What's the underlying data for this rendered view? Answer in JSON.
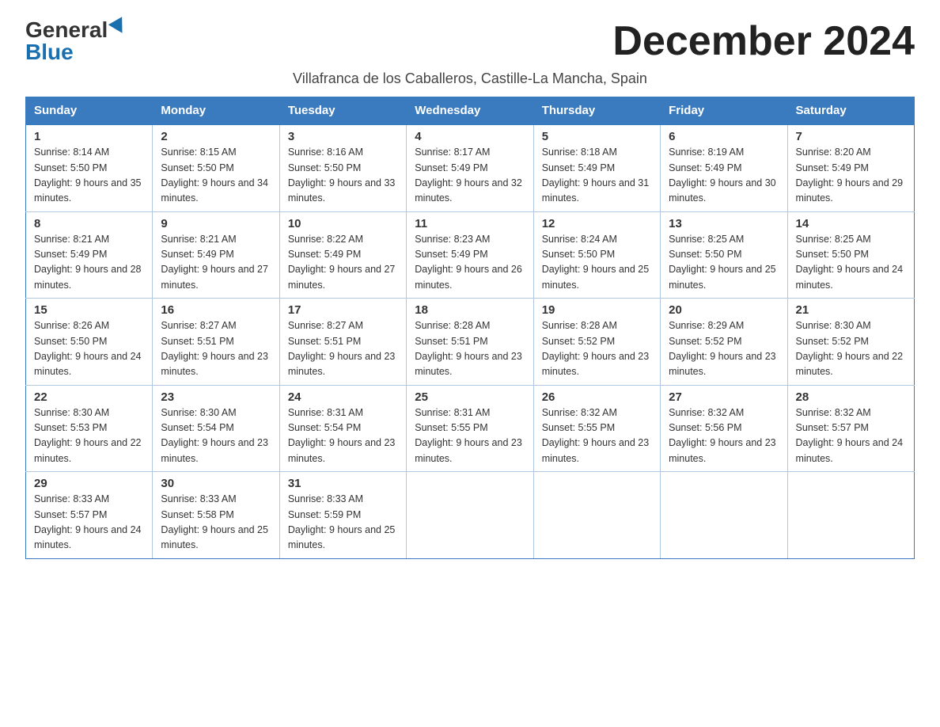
{
  "header": {
    "logo_general": "General",
    "logo_blue": "Blue",
    "month_title": "December 2024",
    "subtitle": "Villafranca de los Caballeros, Castille-La Mancha, Spain"
  },
  "days_of_week": [
    "Sunday",
    "Monday",
    "Tuesday",
    "Wednesday",
    "Thursday",
    "Friday",
    "Saturday"
  ],
  "weeks": [
    [
      {
        "day": "1",
        "sunrise": "8:14 AM",
        "sunset": "5:50 PM",
        "daylight": "9 hours and 35 minutes."
      },
      {
        "day": "2",
        "sunrise": "8:15 AM",
        "sunset": "5:50 PM",
        "daylight": "9 hours and 34 minutes."
      },
      {
        "day": "3",
        "sunrise": "8:16 AM",
        "sunset": "5:50 PM",
        "daylight": "9 hours and 33 minutes."
      },
      {
        "day": "4",
        "sunrise": "8:17 AM",
        "sunset": "5:49 PM",
        "daylight": "9 hours and 32 minutes."
      },
      {
        "day": "5",
        "sunrise": "8:18 AM",
        "sunset": "5:49 PM",
        "daylight": "9 hours and 31 minutes."
      },
      {
        "day": "6",
        "sunrise": "8:19 AM",
        "sunset": "5:49 PM",
        "daylight": "9 hours and 30 minutes."
      },
      {
        "day": "7",
        "sunrise": "8:20 AM",
        "sunset": "5:49 PM",
        "daylight": "9 hours and 29 minutes."
      }
    ],
    [
      {
        "day": "8",
        "sunrise": "8:21 AM",
        "sunset": "5:49 PM",
        "daylight": "9 hours and 28 minutes."
      },
      {
        "day": "9",
        "sunrise": "8:21 AM",
        "sunset": "5:49 PM",
        "daylight": "9 hours and 27 minutes."
      },
      {
        "day": "10",
        "sunrise": "8:22 AM",
        "sunset": "5:49 PM",
        "daylight": "9 hours and 27 minutes."
      },
      {
        "day": "11",
        "sunrise": "8:23 AM",
        "sunset": "5:49 PM",
        "daylight": "9 hours and 26 minutes."
      },
      {
        "day": "12",
        "sunrise": "8:24 AM",
        "sunset": "5:50 PM",
        "daylight": "9 hours and 25 minutes."
      },
      {
        "day": "13",
        "sunrise": "8:25 AM",
        "sunset": "5:50 PM",
        "daylight": "9 hours and 25 minutes."
      },
      {
        "day": "14",
        "sunrise": "8:25 AM",
        "sunset": "5:50 PM",
        "daylight": "9 hours and 24 minutes."
      }
    ],
    [
      {
        "day": "15",
        "sunrise": "8:26 AM",
        "sunset": "5:50 PM",
        "daylight": "9 hours and 24 minutes."
      },
      {
        "day": "16",
        "sunrise": "8:27 AM",
        "sunset": "5:51 PM",
        "daylight": "9 hours and 23 minutes."
      },
      {
        "day": "17",
        "sunrise": "8:27 AM",
        "sunset": "5:51 PM",
        "daylight": "9 hours and 23 minutes."
      },
      {
        "day": "18",
        "sunrise": "8:28 AM",
        "sunset": "5:51 PM",
        "daylight": "9 hours and 23 minutes."
      },
      {
        "day": "19",
        "sunrise": "8:28 AM",
        "sunset": "5:52 PM",
        "daylight": "9 hours and 23 minutes."
      },
      {
        "day": "20",
        "sunrise": "8:29 AM",
        "sunset": "5:52 PM",
        "daylight": "9 hours and 23 minutes."
      },
      {
        "day": "21",
        "sunrise": "8:30 AM",
        "sunset": "5:52 PM",
        "daylight": "9 hours and 22 minutes."
      }
    ],
    [
      {
        "day": "22",
        "sunrise": "8:30 AM",
        "sunset": "5:53 PM",
        "daylight": "9 hours and 22 minutes."
      },
      {
        "day": "23",
        "sunrise": "8:30 AM",
        "sunset": "5:54 PM",
        "daylight": "9 hours and 23 minutes."
      },
      {
        "day": "24",
        "sunrise": "8:31 AM",
        "sunset": "5:54 PM",
        "daylight": "9 hours and 23 minutes."
      },
      {
        "day": "25",
        "sunrise": "8:31 AM",
        "sunset": "5:55 PM",
        "daylight": "9 hours and 23 minutes."
      },
      {
        "day": "26",
        "sunrise": "8:32 AM",
        "sunset": "5:55 PM",
        "daylight": "9 hours and 23 minutes."
      },
      {
        "day": "27",
        "sunrise": "8:32 AM",
        "sunset": "5:56 PM",
        "daylight": "9 hours and 23 minutes."
      },
      {
        "day": "28",
        "sunrise": "8:32 AM",
        "sunset": "5:57 PM",
        "daylight": "9 hours and 24 minutes."
      }
    ],
    [
      {
        "day": "29",
        "sunrise": "8:33 AM",
        "sunset": "5:57 PM",
        "daylight": "9 hours and 24 minutes."
      },
      {
        "day": "30",
        "sunrise": "8:33 AM",
        "sunset": "5:58 PM",
        "daylight": "9 hours and 25 minutes."
      },
      {
        "day": "31",
        "sunrise": "8:33 AM",
        "sunset": "5:59 PM",
        "daylight": "9 hours and 25 minutes."
      },
      null,
      null,
      null,
      null
    ]
  ]
}
